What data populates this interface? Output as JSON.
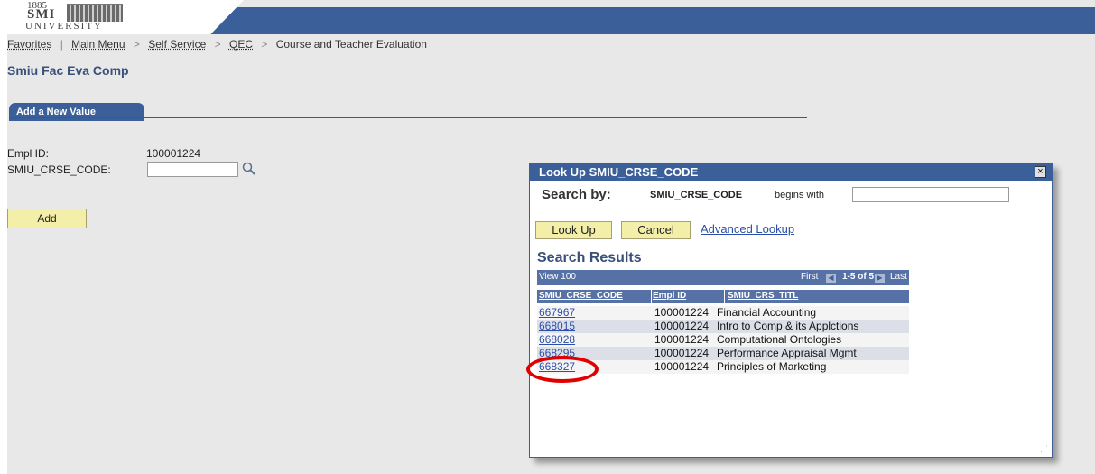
{
  "header": {
    "logo": {
      "year": "1885",
      "name_top": "SMI",
      "name_bottom": "UNIVERSITY"
    }
  },
  "breadcrumb": [
    "Favorites",
    "Main Menu",
    ">",
    "Self Service",
    ">",
    "QEC",
    ">",
    "Course and Teacher Evaluation"
  ],
  "page_title": "Smiu Fac Eva Comp",
  "tab_label": "Add a New Value",
  "form": {
    "empl_label": "Empl ID:",
    "empl_value": "100001224",
    "crse_label": "SMIU_CRSE_CODE:",
    "crse_value": "",
    "add_label": "Add"
  },
  "dialog": {
    "title": "Look Up SMIU_CRSE_CODE",
    "close": "×",
    "search_by": "Search by:",
    "search_field": "SMIU_CRSE_CODE",
    "search_op": "begins with",
    "search_value": "",
    "lookup_label": "Look Up",
    "cancel_label": "Cancel",
    "advanced_label": "Advanced Lookup",
    "results_title": "Search Results",
    "grid": {
      "view": "View 100",
      "first": "First",
      "range": "1-5 of 5",
      "last": "Last",
      "columns": [
        "SMIU_CRSE_CODE",
        "Empl ID",
        "SMIU_CRS_TITL"
      ],
      "rows": [
        {
          "code": "667967",
          "empl": "100001224",
          "title": "Financial Accounting"
        },
        {
          "code": "668015",
          "empl": "100001224",
          "title": "Intro to Comp & its Applctions"
        },
        {
          "code": "668028",
          "empl": "100001224",
          "title": "Computational Ontologies"
        },
        {
          "code": "668295",
          "empl": "100001224",
          "title": "Performance Appraisal Mgmt"
        },
        {
          "code": "668327",
          "empl": "100001224",
          "title": "Principles of Marketing"
        }
      ]
    }
  },
  "colors": {
    "header": "#3b5f98",
    "button": "#f3eea8",
    "link": "#2b4fa8",
    "highlight": "#e00000"
  }
}
